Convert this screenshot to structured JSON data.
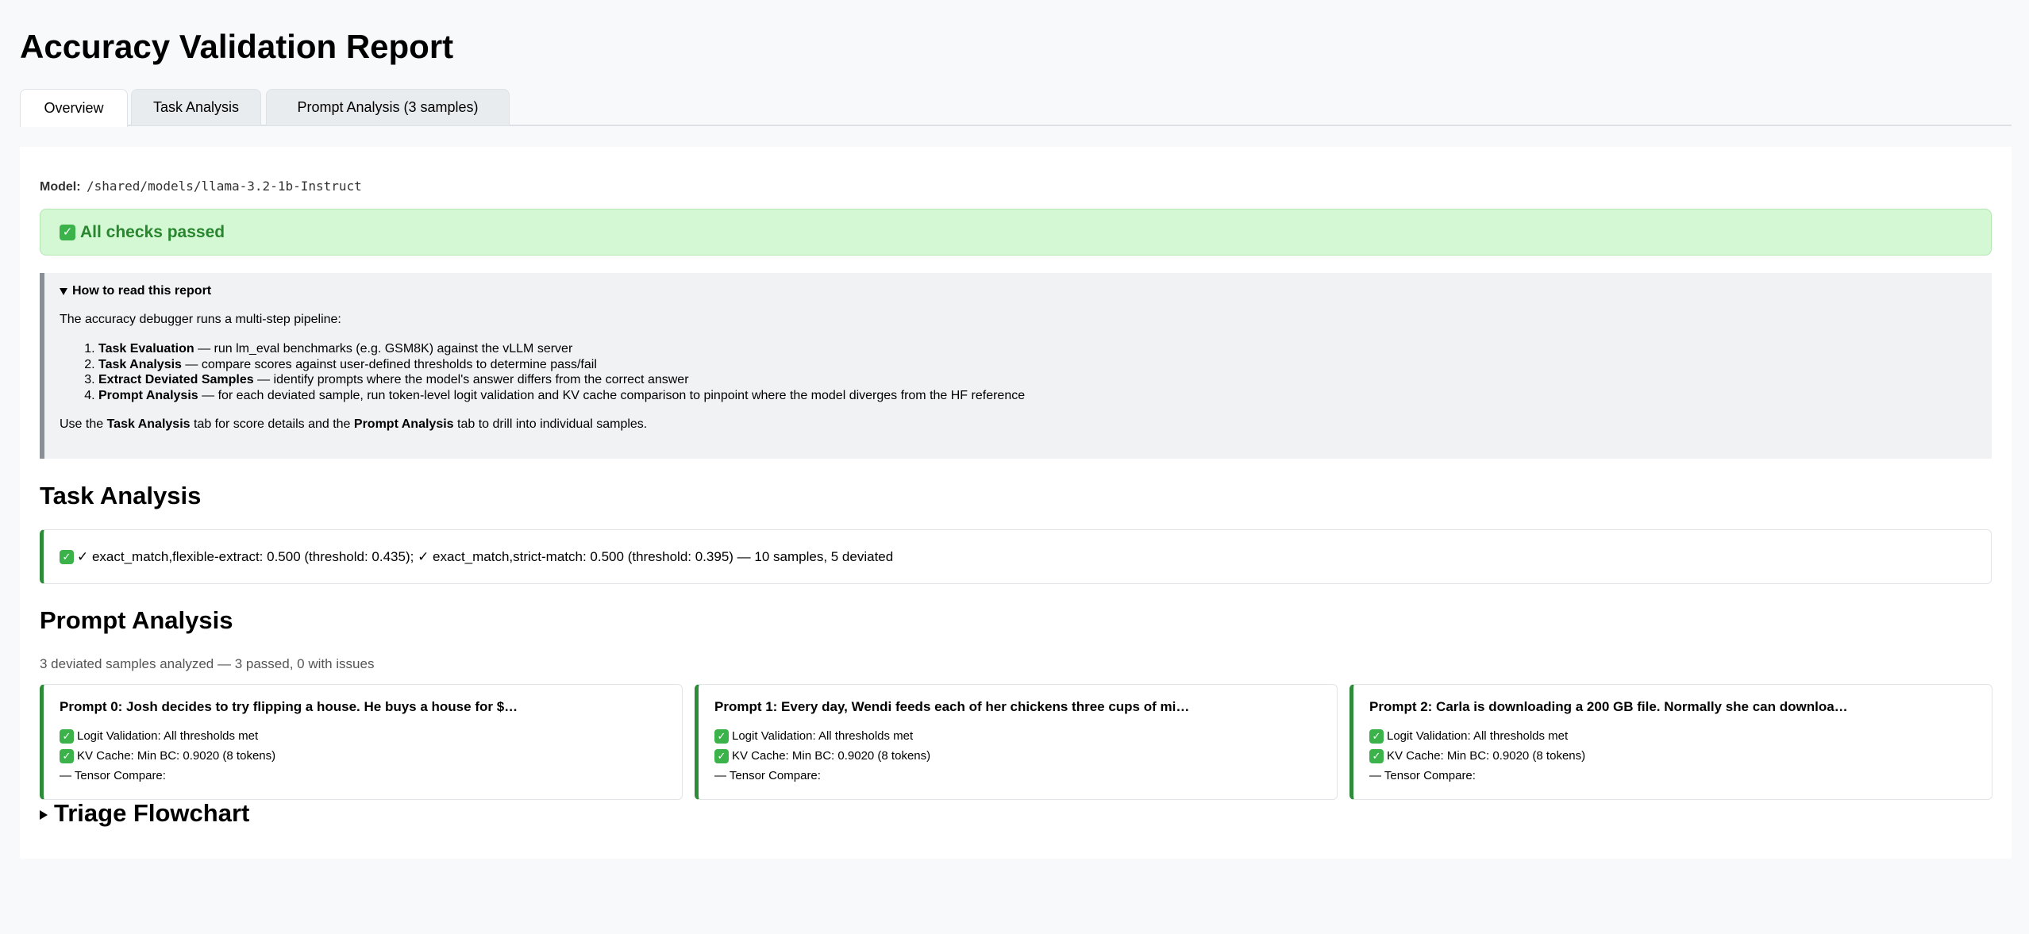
{
  "title": "Accuracy Validation Report",
  "tabs": [
    {
      "label": "Overview",
      "active": true
    },
    {
      "label": "Task Analysis",
      "active": false
    },
    {
      "label": "Prompt Analysis (3 samples)",
      "active": false
    }
  ],
  "model": {
    "label": "Model:",
    "path": "/shared/models/llama-3.2-1b-Instruct"
  },
  "status": {
    "icon": "check-icon",
    "text": "All checks passed",
    "color": "#28862e",
    "background": "#d4f8d4"
  },
  "howto": {
    "summary": "How to read this report",
    "intro": "The accuracy debugger runs a multi-step pipeline:",
    "steps": [
      {
        "name": "Task Evaluation",
        "desc": " — run lm_eval benchmarks (e.g. GSM8K) against the vLLM server"
      },
      {
        "name": "Task Analysis",
        "desc": " — compare scores against user-defined thresholds to determine pass/fail"
      },
      {
        "name": "Extract Deviated Samples",
        "desc": " — identify prompts where the model's answer differs from the correct answer"
      },
      {
        "name": "Prompt Analysis",
        "desc": " — for each deviated sample, run token-level logit validation and KV cache comparison to pinpoint where the model diverges from the HF reference"
      }
    ],
    "outro": {
      "part1": "Use the ",
      "b1": "Task Analysis",
      "part2": " tab for score details and the ",
      "b2": "Prompt Analysis",
      "part3": " tab to drill into individual samples."
    }
  },
  "task_analysis": {
    "heading": "Task Analysis",
    "result": "✓ exact_match,flexible-extract: 0.500 (threshold: 0.435); ✓ exact_match,strict-match: 0.500 (threshold: 0.395) — 10 samples, 5 deviated"
  },
  "prompt_analysis": {
    "heading": "Prompt Analysis",
    "summary": "3 deviated samples analyzed — 3 passed, 0 with issues",
    "cards": [
      {
        "title": "Prompt 0: Josh decides to try flipping a house. He buys a house for $…",
        "logit": "Logit Validation: All thresholds met",
        "kv": "KV Cache: Min BC: 0.9020 (8 tokens)",
        "tensor": "— Tensor Compare:"
      },
      {
        "title": "Prompt 1: Every day, Wendi feeds each of her chickens three cups of mi…",
        "logit": "Logit Validation: All thresholds met",
        "kv": "KV Cache: Min BC: 0.9020 (8 tokens)",
        "tensor": "— Tensor Compare:"
      },
      {
        "title": "Prompt 2: Carla is downloading a 200 GB file. Normally she can downloa…",
        "logit": "Logit Validation: All thresholds met",
        "kv": "KV Cache: Min BC: 0.9020 (8 tokens)",
        "tensor": "— Tensor Compare:"
      }
    ]
  },
  "triage": {
    "label": "Triage Flowchart"
  },
  "colors": {
    "accent_green": "#2e8b3a",
    "check_green": "#3bb34a"
  }
}
